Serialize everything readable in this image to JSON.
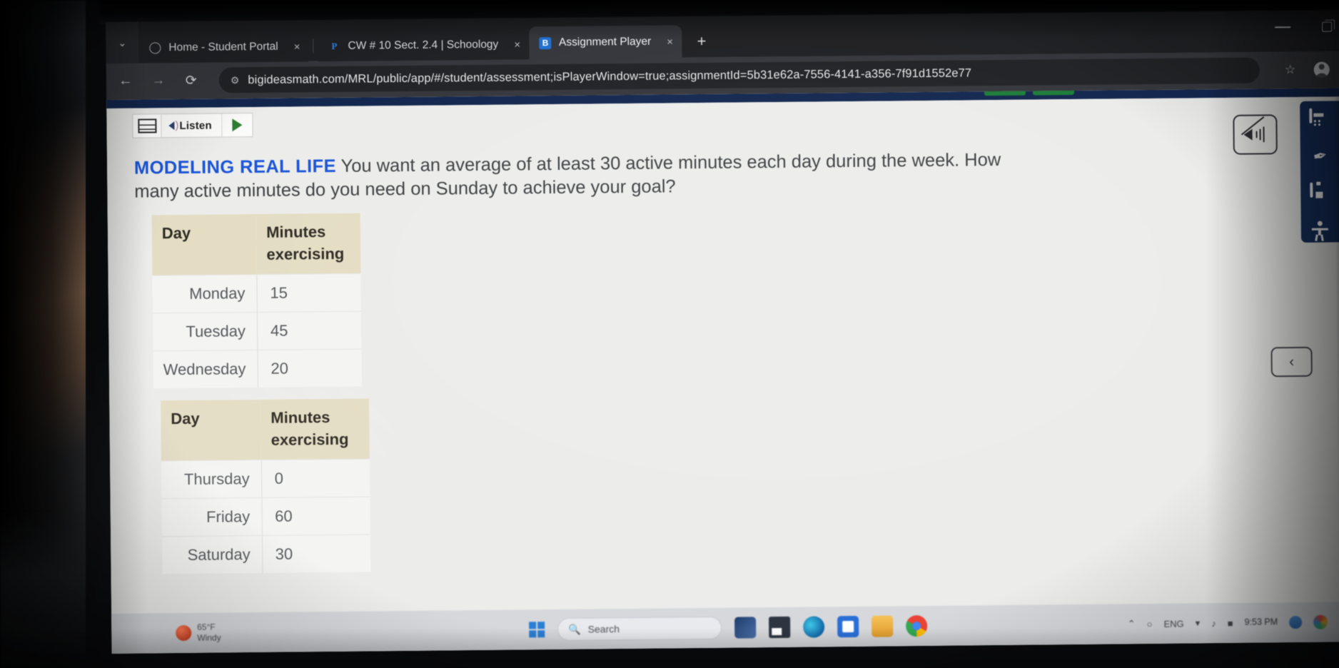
{
  "browser": {
    "tabs": [
      {
        "title": "Home - Student Portal",
        "favicon": "globe-icon",
        "active": false
      },
      {
        "title": "CW # 10 Sect. 2.4 | Schoology",
        "favicon": "schoology-icon",
        "active": false
      },
      {
        "title": "Assignment Player",
        "favicon": "bigideas-icon",
        "active": true
      }
    ],
    "new_tab_label": "+",
    "tab_close_label": "×",
    "tab_search_label": "⌄",
    "nav": {
      "back": "←",
      "forward": "→",
      "reload": "⟳"
    },
    "url": "bigideasmath.com/MRL/public/app/#/student/assessment;isPlayerWindow=true;assignmentId=5b31e62a-7556-4141-a356-7f91d1552e77",
    "site_icon": "tune-icon",
    "bookmark_label": "☆",
    "window_controls": {
      "minimize": "minimize-icon",
      "restore": "restore-icon"
    }
  },
  "player": {
    "listen": {
      "stamp_icon": "readspeaker-icon",
      "speaker_icon": "speaker-icon",
      "label": "Listen",
      "play_icon": "play-icon"
    },
    "question": {
      "tag": "MODELING REAL LIFE",
      "text": " You want an average of at least 30 active minutes each day during the week. How many active minutes do you need on Sunday to achieve your goal?"
    },
    "tables": [
      {
        "headers": [
          "Day",
          "Minutes exercising"
        ],
        "rows": [
          {
            "day": "Monday",
            "minutes": "15"
          },
          {
            "day": "Tuesday",
            "minutes": "45"
          },
          {
            "day": "Wednesday",
            "minutes": "20"
          }
        ]
      },
      {
        "headers": [
          "Day",
          "Minutes exercising"
        ],
        "rows": [
          {
            "day": "Thursday",
            "minutes": "0"
          },
          {
            "day": "Friday",
            "minutes": "60"
          },
          {
            "day": "Saturday",
            "minutes": "30"
          }
        ]
      }
    ],
    "mute_button": "mute-speaker-icon",
    "rail": [
      {
        "name": "calculator-icon"
      },
      {
        "name": "annotate-icon",
        "glyph": "✒"
      },
      {
        "name": "notes-icon"
      },
      {
        "name": "accessibility-icon"
      }
    ],
    "prev_button": "‹"
  },
  "taskbar": {
    "weather": {
      "temp": "65°F",
      "condition": "Windy",
      "icon": "weather-icon"
    },
    "start_label": "windows-start-icon",
    "search_placeholder": "Search",
    "apps": [
      {
        "name": "widgets-icon"
      },
      {
        "name": "teams-icon"
      },
      {
        "name": "edge-icon"
      },
      {
        "name": "store-icon"
      },
      {
        "name": "file-explorer-icon"
      },
      {
        "name": "chrome-icon"
      }
    ],
    "tray": {
      "overflow": "⌃",
      "onedrive": "○",
      "language": "ENG",
      "wifi": "wifi-icon",
      "volume": "volume-icon",
      "battery": "battery-icon"
    },
    "clock": {
      "time": "9:53 PM",
      "date": ""
    },
    "notification_badge": "notification-icon",
    "copilot": "copilot-icon"
  }
}
